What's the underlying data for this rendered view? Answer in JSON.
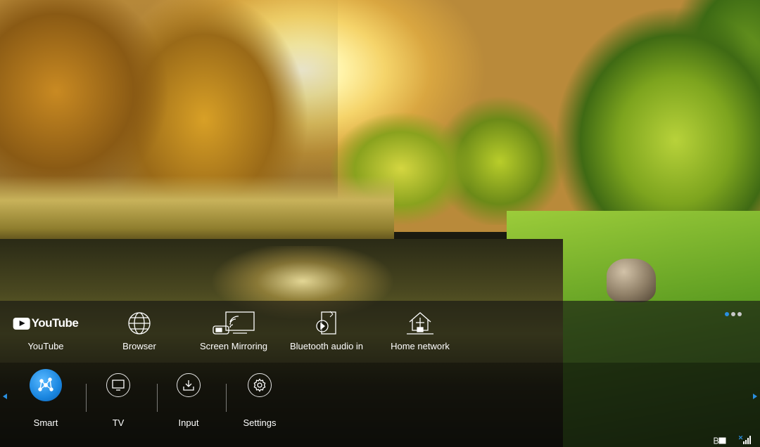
{
  "apps": [
    {
      "label": "YouTube",
      "icon": "youtube-logo-icon",
      "logo_text": "YouTube"
    },
    {
      "label": "Browser",
      "icon": "globe-icon"
    },
    {
      "label": "Screen Mirroring",
      "icon": "screen-mirroring-icon"
    },
    {
      "label": "Bluetooth audio in",
      "icon": "bluetooth-audio-icon"
    },
    {
      "label": "Home network",
      "icon": "home-network-icon"
    }
  ],
  "page_indicator": {
    "count": 3,
    "active": 1
  },
  "nav": [
    {
      "label": "Smart",
      "icon": "smart-hub-icon",
      "active": true
    },
    {
      "label": "TV",
      "icon": "tv-icon",
      "active": false
    },
    {
      "label": "Input",
      "icon": "input-icon",
      "active": false
    },
    {
      "label": "Settings",
      "icon": "gear-icon",
      "active": false
    }
  ],
  "colors": {
    "accent": "#2a8fe0",
    "strip_bg": "#121212",
    "text": "#ffffff"
  }
}
